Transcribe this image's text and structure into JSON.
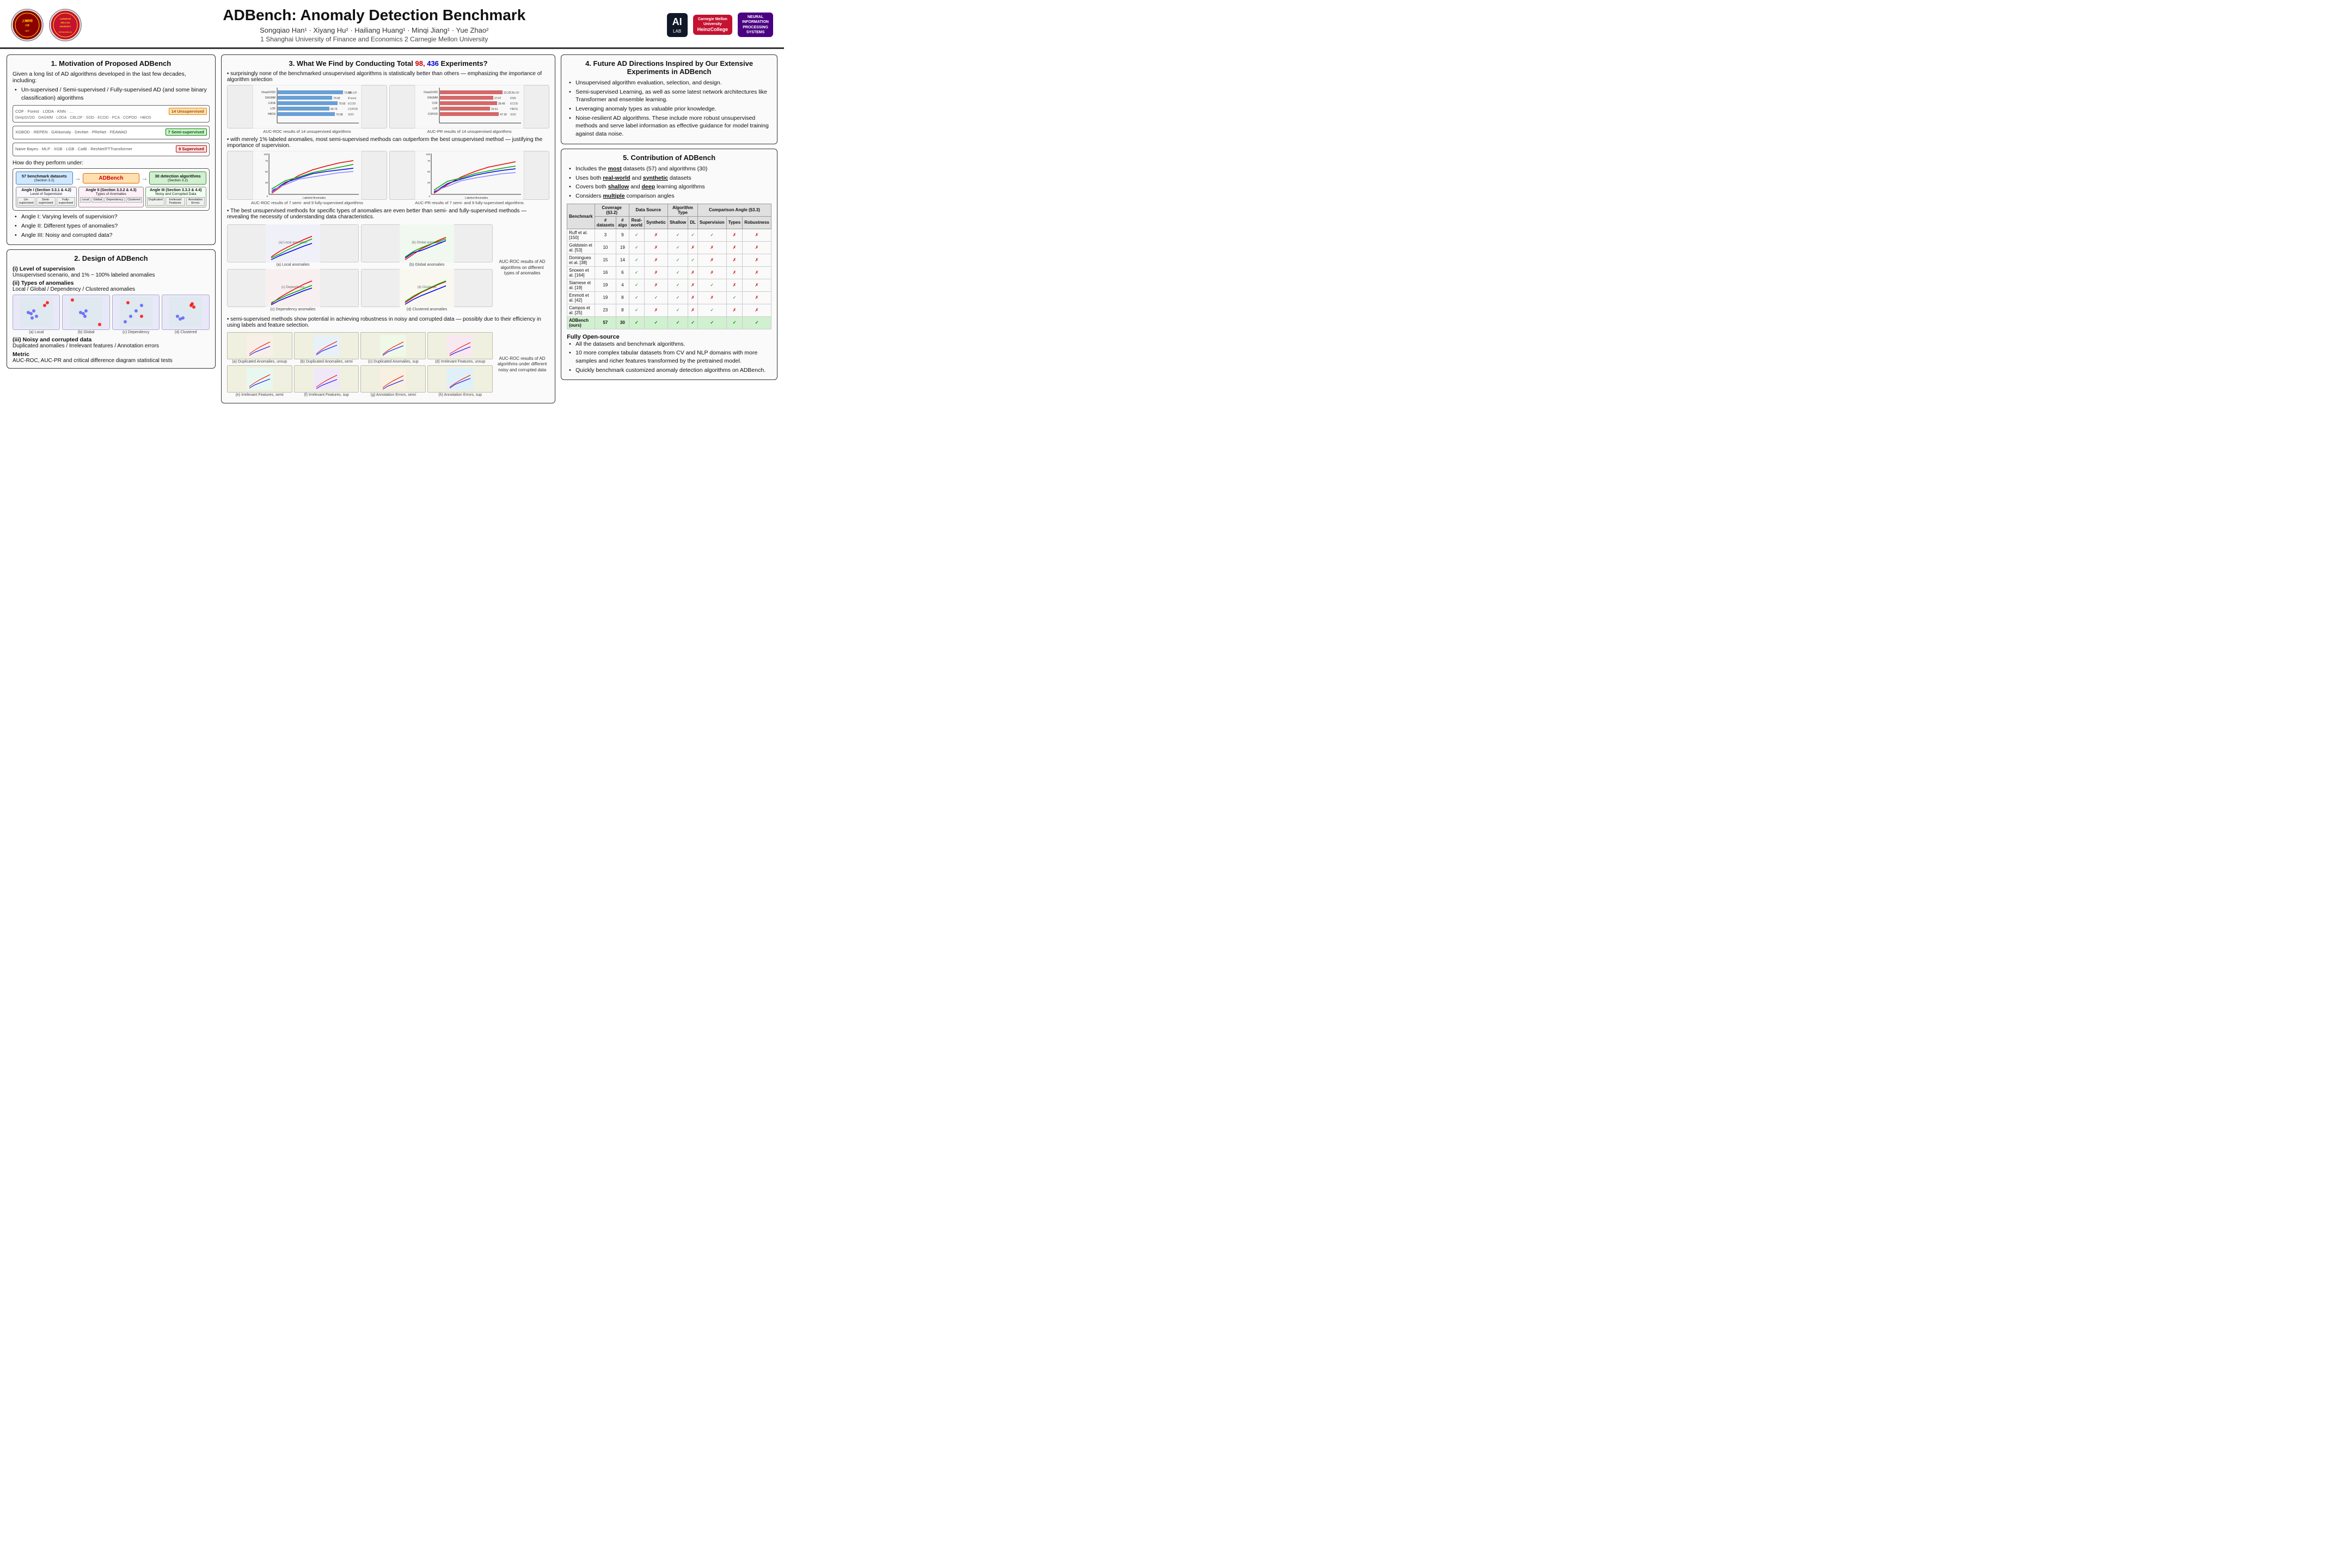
{
  "header": {
    "title": "ADBench: Anomaly Detection Benchmark",
    "authors": "Songqiao Han¹ · Xiyang Hu² · Hailiang Huang¹ · Minqi Jiang¹ · Yue Zhao²",
    "affiliation": "1 Shanghai University of Finance and Economics  2 Carnegie Mellon University"
  },
  "section1": {
    "title": "1. Motivation of Proposed ADBench",
    "intro": "Given a long list of AD algorithms developed in the last few decades, including:",
    "bullets": [
      "Un-supervised / Semi-supervised / Fully-supervised AD (and some binary classification) algorithms"
    ],
    "question": "How do they perform under:",
    "angles": [
      "Angle I: Varying levels of supervision?",
      "Angle II: Different types of anomalies?",
      "Angle III: Noisy and corrupted data?"
    ],
    "algo_labels": {
      "unsupervised": "14 Unsupervised",
      "semi": "7 Semi-supervised",
      "supervised": "9 Supervised"
    }
  },
  "section2": {
    "title": "2. Design of ADBench",
    "supervision_title": "(i) Level of supervision",
    "supervision_desc": "Unsupervised scenario, and 1% ~ 100% labeled anomalies",
    "types_title": "(ii) Types of anomalies",
    "types_desc": "Local / Global / Dependency / Clustered anomalies",
    "scatter_labels": [
      "(a) Local",
      "(b) Global",
      "(c) Dependency",
      "(d) Clustered"
    ],
    "noisy_title": "(iii) Noisy and corrupted data",
    "noisy_desc": "Duplicated anomalies / Irrelevant features / Annotation errors",
    "metric_title": "Metric",
    "metric_desc": "AUC-ROC, AUC-PR and critical difference diagram statistical tests"
  },
  "section3": {
    "title": "3. What We Find by Conducting Total",
    "highlight1": "98,",
    "highlight2": "436",
    "title_end": "Experiments?",
    "finding1": "surprisingly none of the benchmarked unsupervised algorithms is statistically better than others — emphasizing the importance of algorithm selection",
    "chart1_caption": "AUC-ROC results of 14 unsupervised algorithms",
    "chart2_caption": "AUC-PR results of 14 unsupervised algorithms",
    "finding2": "with merely 1% labeled anomalies, most semi-supervised methods can outperform the best unsupervised method — justifying the importance of supervision.",
    "chart3_caption": "AUC-ROC results of 7 semi- and 9 fully-supervised algorithms",
    "chart4_caption": "AUC-PR results of 7 semi- and 9 fully-supervised algorithms",
    "finding3": "The best unsupervised methods for specific types of anomalies are even better than semi- and fully-supervised methods — revealing the necessity of understanding data characteristics.",
    "finding4": "semi-supervised methods show potential in achieving robustness in noisy and corrupted data — possibly due to their efficiency in using labels and feature selection.",
    "anom_types_label": "AUC-ROC results of AD algorithms on different types of anomalies",
    "noisy_label": "AUC-ROC results of AD algorithms under different noisy and corrupted data",
    "labeled_anom_label": "Labeled Anomalies",
    "sub_chart_labels": [
      "(a) Local anomalies",
      "(b) Global anomalies",
      "(c) Dependency anomalies",
      "(d) Clustered anomalies"
    ],
    "noisy_sub_labels": [
      "(a) Duplicated Anomalies, unsup",
      "(b) Duplicated Anomalies, semi",
      "(c) Duplicated Anomalies, sup",
      "(d) Irrelevant Features, unsup"
    ],
    "noisy_sub_labels2": [
      "(e) Irrelevant Features, semi",
      "(f) Irrelevant Features, sup",
      "(g) Annotation Errors, semi",
      "(h) Annotation Errors, sup"
    ]
  },
  "section4": {
    "title": "4. Future AD Directions Inspired by Our Extensive Experiments in ADBench",
    "bullets": [
      "Unsupervised algorithm evaluation, selection, and design.",
      "Semi-supervised Learning, as well as some latest network architectures like Transformer and ensemble learning.",
      "Leveraging anomaly types as valuable prior knowledge.",
      "Noise-resilient AD algorithms. These include more robust unsupervised methods and serve label information as effective guidance for model training against data noise."
    ]
  },
  "section5": {
    "title": "5. Contribution of ADBench",
    "bullets": [
      "Includes the most datasets (57) and algorithms (30)",
      "Uses both real-world and synthetic datasets",
      "Covers both shallow and deep learning algorithms",
      "Considers multiple comparison angles"
    ],
    "table": {
      "headers": [
        "Benchmark",
        "Coverage (§3.2)",
        "",
        "Data Source",
        "",
        "Algorithm Type",
        "",
        "Comparison Angle (§3.3)",
        "",
        ""
      ],
      "subheaders": [
        "",
        "# datasets",
        "# algo",
        "Real-world",
        "Synthetic",
        "Shallow",
        "DL",
        "Supervision",
        "Types",
        "Robustness"
      ],
      "rows": [
        [
          "Ruff et al. [150]",
          "3",
          "9",
          "✓",
          "✗",
          "✓",
          "✓",
          "✓",
          "✗",
          "✗"
        ],
        [
          "Goldstein et al. [53]",
          "10",
          "19",
          "✓",
          "✗",
          "✓",
          "✗",
          "✗",
          "✗",
          "✗"
        ],
        [
          "Domingues et al. [38]",
          "15",
          "14",
          "✓",
          "✗",
          "✓",
          "✓",
          "✗",
          "✗",
          "✗"
        ],
        [
          "Snoeen et al. [164]",
          "16",
          "6",
          "✓",
          "✗",
          "✓",
          "✗",
          "✗",
          "✗",
          "✗"
        ],
        [
          "Siamese et al. [19]",
          "19",
          "4",
          "✓",
          "✗",
          "✓",
          "✗",
          "✓",
          "✗",
          "✗"
        ],
        [
          "Emmott et al. [42]",
          "19",
          "8",
          "✓",
          "✓",
          "✓",
          "✗",
          "✗",
          "✓",
          "✗"
        ],
        [
          "Campos et al. [25]",
          "23",
          "8",
          "✓",
          "✗",
          "✓",
          "✗",
          "✓",
          "✗",
          "✗"
        ],
        [
          "ADBench (ours)",
          "57",
          "30",
          "✓",
          "✓",
          "✓",
          "✓",
          "✓",
          "✓",
          "✓"
        ]
      ]
    },
    "open_source_title": "Fully Open-source",
    "open_source_bullets": [
      "All the datasets and benchmark algorithms.",
      "10 more complex tabular datasets from CV and NLP domains with more samples and richer features transformed by the pretrained model.",
      "Quickly benchmark customized anomaly detection algorithms on ADBench."
    ]
  },
  "logos": {
    "left": [
      "SHANGHAI UNIVERSITY OF FINANCE & ECONOMICS 1917",
      "CARNEGIE MELLON UNIVERSITY"
    ],
    "right": [
      "AI LAB",
      "Carnegie Mellon University HeinzCollege",
      "NEURAL INFORMATION PROCESSING SYSTEMS"
    ]
  }
}
